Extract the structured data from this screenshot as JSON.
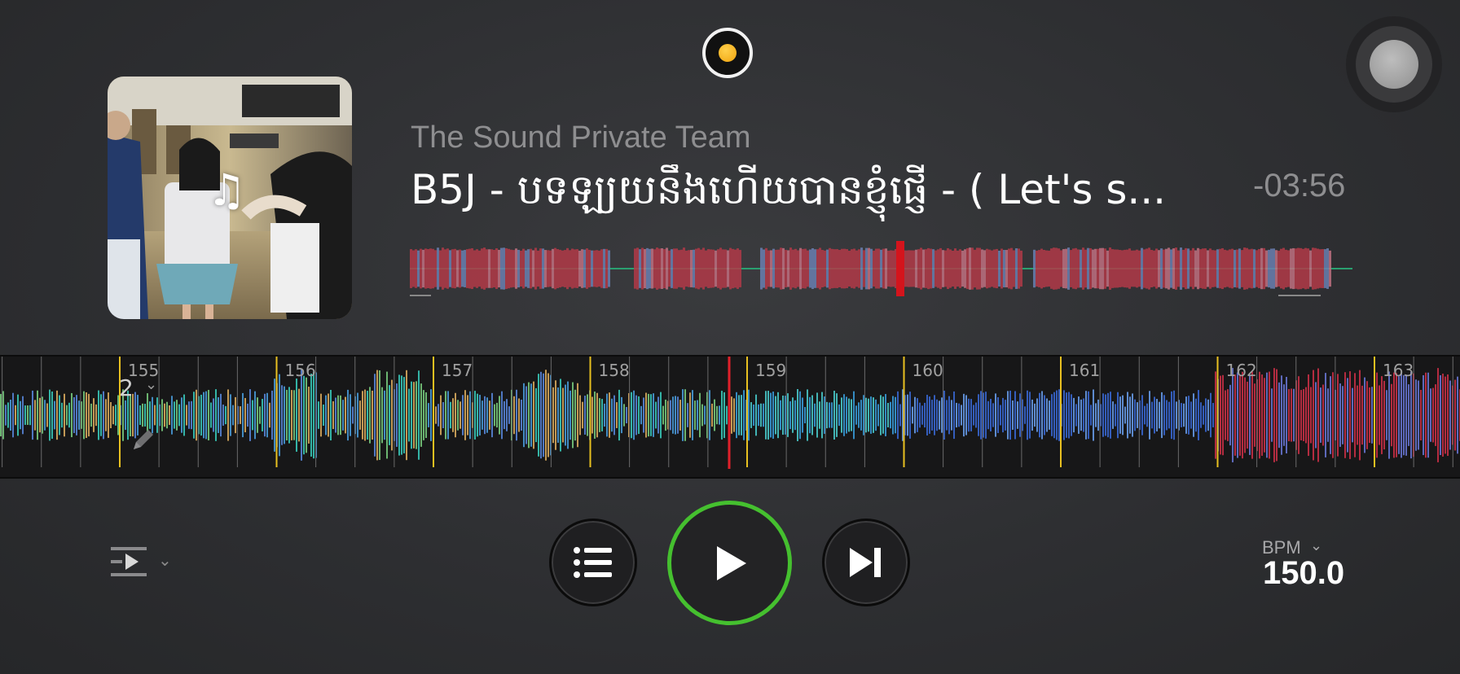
{
  "header": {
    "record_icon": "record-icon",
    "assist_icon": "assistive-touch-icon"
  },
  "track": {
    "artist": "The Sound Private Team",
    "title": "B5J - បទឡ្យយនឹងហើយបានខ្ញុំផ្ញើ - ( Let's s...",
    "time_remaining": "-03:56",
    "artwork_icon": "music-note-icon",
    "playhead_position": 0.52
  },
  "waveform": {
    "bar_numbers": [
      "155",
      "156",
      "157",
      "158",
      "159",
      "160",
      "161",
      "162",
      "163"
    ],
    "loop_size": "2",
    "edit_icon": "pencil-icon"
  },
  "transport": {
    "queue_icon": "list-icon",
    "play_icon": "play-icon",
    "next_icon": "skip-next-icon",
    "play_mode_icon": "play-mode-icon",
    "accent_color": "#45c02f"
  },
  "tempo": {
    "label": "BPM",
    "value": "150.0"
  }
}
